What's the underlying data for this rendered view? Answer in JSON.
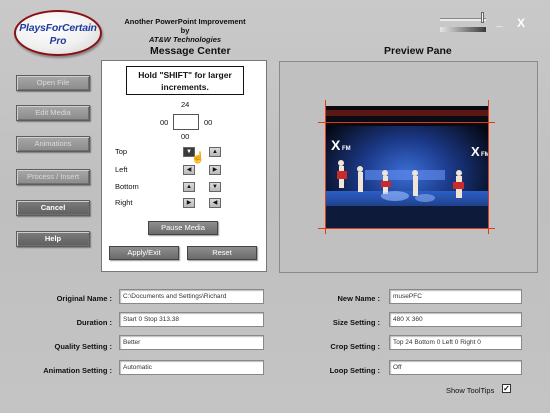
{
  "logo": {
    "line1": "PlaysForCertain",
    "line2": "Pro"
  },
  "header": {
    "tagline_line1": "Another PowerPoint Improvement by",
    "tagline_line2": "AT&W Technologies",
    "minimize_label": "_",
    "close_label": "X"
  },
  "nav": {
    "open_file": "Open File",
    "edit_media": "Edit Media",
    "animations": "Animations",
    "process_insert": "Process / Insert",
    "cancel": "Cancel",
    "help": "Help"
  },
  "message_center": {
    "title": "Message Center",
    "hint": "Hold \"SHIFT\" for larger increments.",
    "top_value": "24",
    "left_value": "00",
    "right_value": "00",
    "bottom_value": "00",
    "labels": {
      "top": "Top",
      "left": "Left",
      "bottom": "Bottom",
      "right": "Right"
    },
    "arrow_up": "▲",
    "arrow_down": "▼",
    "arrow_left": "◀",
    "arrow_right": "▶",
    "pause_label": "Pause Media",
    "apply_label": "Apply/Exit",
    "reset_label": "Reset"
  },
  "preview": {
    "title": "Preview Pane",
    "logo_text": "XFM"
  },
  "fields": {
    "original_name_label": "Original Name :",
    "original_name_value": "C:\\Documents and Settings\\Richard",
    "duration_label": "Duration :",
    "duration_value": "Start 0 Stop 313.38",
    "quality_label": "Quality Setting :",
    "quality_value": "Better",
    "animation_label": "Animation Setting :",
    "animation_value": "Automatic",
    "new_name_label": "New Name :",
    "new_name_value": "musePFC",
    "size_label": "Size Setting :",
    "size_value": "480 X 360",
    "crop_label": "Crop Setting :",
    "crop_value": "Top 24 Bottom 0 Left 0 Right 0",
    "loop_label": "Loop Setting :",
    "loop_value": "Off"
  },
  "tooltips": {
    "label": "Show ToolTips",
    "checked": true,
    "check_mark": "✓"
  },
  "colors": {
    "crop_line": "#e23a17",
    "logo_border": "#8a0f12",
    "logo_text": "#1f3b9c"
  }
}
